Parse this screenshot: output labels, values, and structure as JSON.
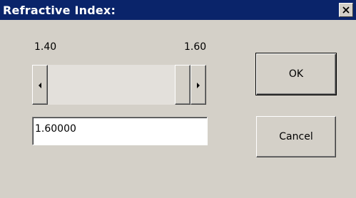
{
  "dialog": {
    "title": "Refractive Index:",
    "close_icon": "close-icon"
  },
  "slider": {
    "min_label": "1.40",
    "max_label": "1.60",
    "position_fraction": 1.0,
    "left_icon": "arrow-left-icon",
    "right_icon": "arrow-right-icon"
  },
  "value_field": {
    "value": "1.60000"
  },
  "buttons": {
    "ok_label": "OK",
    "cancel_label": "Cancel"
  },
  "colors": {
    "title_bar": "#0a246a",
    "face": "#d4d0c8"
  }
}
